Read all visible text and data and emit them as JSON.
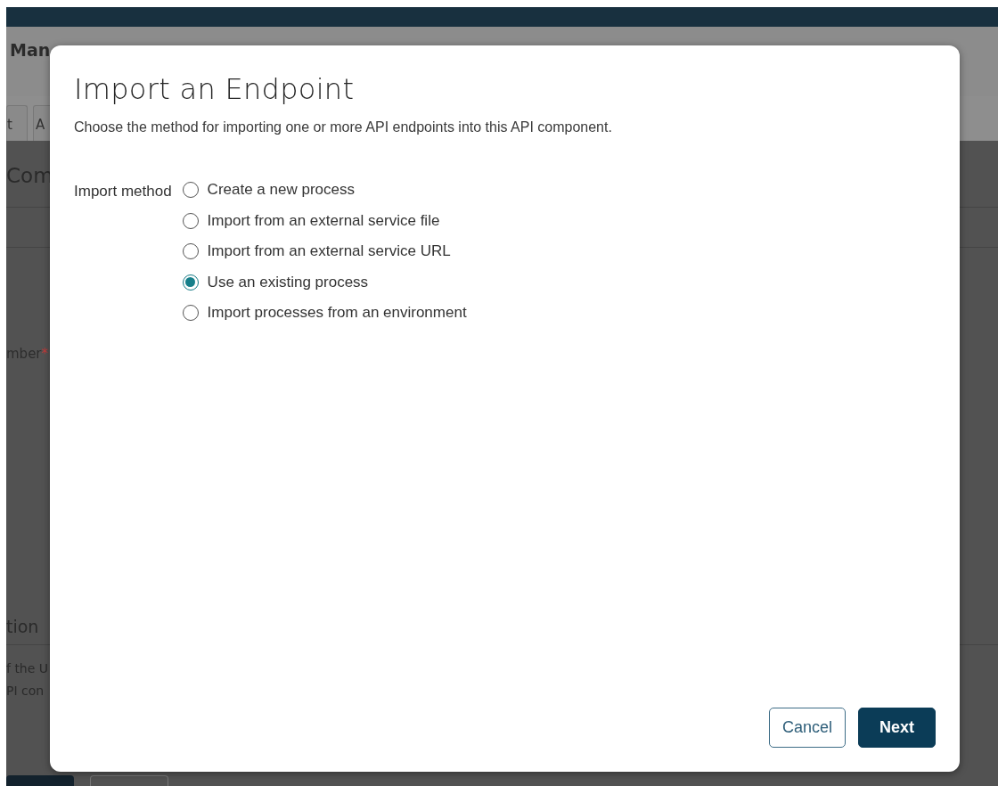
{
  "background": {
    "header_title": "Man",
    "tabs": [
      "t",
      "A"
    ],
    "section_title": "Com",
    "field_label": "mber",
    "required_mark": "*",
    "section2_title": "tion",
    "text_lines": [
      "f the U",
      "PI con"
    ]
  },
  "dialog": {
    "title": "Import an Endpoint",
    "description": "Choose the method for importing one or more API endpoints into this API component.",
    "field_label": "Import method",
    "options": [
      {
        "label": "Create a new process",
        "selected": false
      },
      {
        "label": "Import from an external service file",
        "selected": false
      },
      {
        "label": "Import from an external service URL",
        "selected": false
      },
      {
        "label": "Use an existing process",
        "selected": true
      },
      {
        "label": "Import processes from an environment",
        "selected": false
      }
    ],
    "buttons": [
      {
        "label": "Cancel",
        "kind": "secondary"
      },
      {
        "label": "Next",
        "kind": "primary"
      }
    ]
  }
}
